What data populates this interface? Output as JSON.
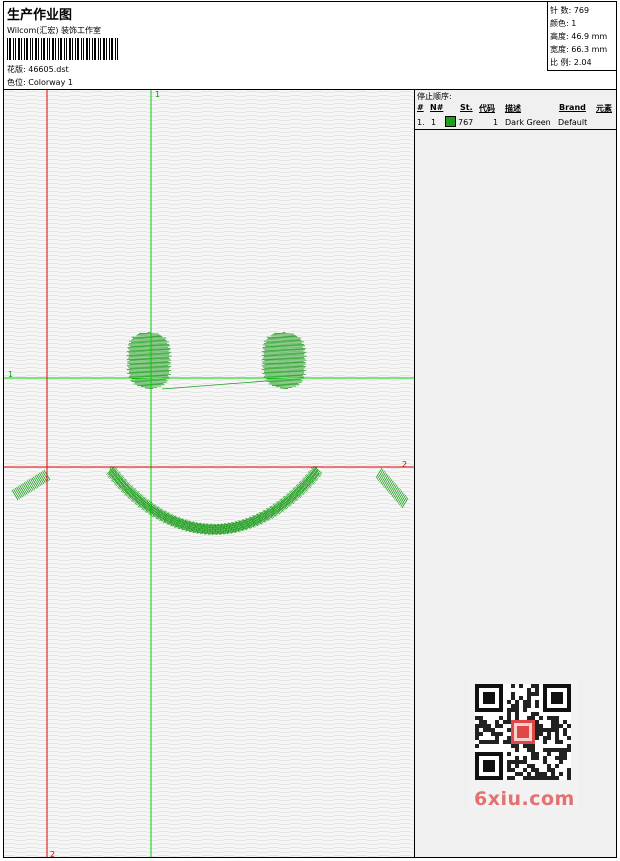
{
  "header": {
    "title": "生产作业图",
    "subtitle": "Wilcom(汇宏) 装饰工作室",
    "design_label": "花版:",
    "design_value": "46605.dst",
    "colorway_label": "色位:",
    "colorway_value": "Colorway 1"
  },
  "stats": {
    "stitches": "针 数: 769",
    "colors": "颜色: 1",
    "height": "高度: 46.9 mm",
    "width": "宽度: 66.3 mm",
    "scale": "比 例: 2.04"
  },
  "guides": {
    "green_vertical": "1",
    "green_horizontal": "1",
    "red_horizontal": "2",
    "red_vertical": "2"
  },
  "sequence": {
    "title": "停止顺序:",
    "headers": [
      "#",
      "N#",
      "St.",
      "代码",
      "描述",
      "Brand",
      "元素"
    ],
    "rows": [
      {
        "num": "1.",
        "n": "1",
        "stitches": "767",
        "code": "1",
        "desc": "Dark Green",
        "brand": "Default",
        "swatch": "#1f9e1f"
      }
    ]
  },
  "colors": {
    "thread": "#1f9e1f",
    "green_guide": "#00d000",
    "red_guide": "#e00000"
  },
  "watermark": "6xiu.com"
}
